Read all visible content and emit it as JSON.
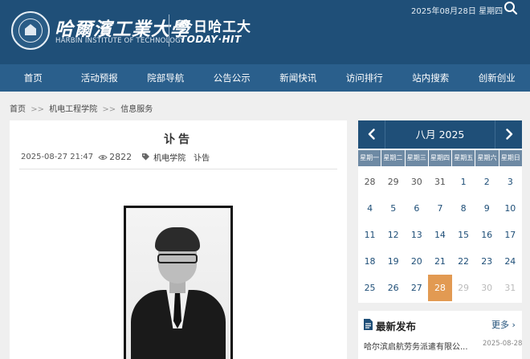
{
  "header": {
    "logo_cn": "哈爾濱工業大學",
    "logo_en": "HARBIN INSTITUTE OF TECHNOLOGY",
    "today_cn": "今日哈工大",
    "today_en": "TODAY·HIT",
    "date": "2025年08月28日 星期四"
  },
  "nav": [
    "首页",
    "活动预报",
    "院部导航",
    "公告公示",
    "新闻快讯",
    "访问排行",
    "站内搜索",
    "创新创业"
  ],
  "breadcrumb": {
    "home": "首页",
    "sep": ">>",
    "level1": "机电工程学院",
    "level2": "信息服务"
  },
  "article": {
    "title": "讣告",
    "datetime": "2025-08-27 21:47",
    "views": "2822",
    "tags": [
      "机电学院",
      "讣告"
    ]
  },
  "calendar": {
    "month_label": "八月 2025",
    "weekdays": [
      "星期一",
      "星期二",
      "星期三",
      "星期四",
      "星期五",
      "星期六",
      "星期日"
    ],
    "today": "28",
    "rows": [
      [
        "28",
        "29",
        "30",
        "31",
        "1",
        "2",
        "3"
      ],
      [
        "4",
        "5",
        "6",
        "7",
        "8",
        "9",
        "10"
      ],
      [
        "11",
        "12",
        "13",
        "14",
        "15",
        "16",
        "17"
      ],
      [
        "18",
        "19",
        "20",
        "21",
        "22",
        "23",
        "24"
      ],
      [
        "25",
        "26",
        "27",
        "28",
        "29",
        "30",
        "31"
      ]
    ],
    "accent_color": "#e29a52"
  },
  "latest": {
    "title": "最新发布",
    "more": "更多 ›",
    "item": "哈尔滨启航劳务派遣有限公...",
    "item_date": "2025-08-28"
  },
  "colors": {
    "header_bg": "#1f4f78",
    "nav_bg": "#2a5f8c",
    "page_bg": "#efefef"
  }
}
